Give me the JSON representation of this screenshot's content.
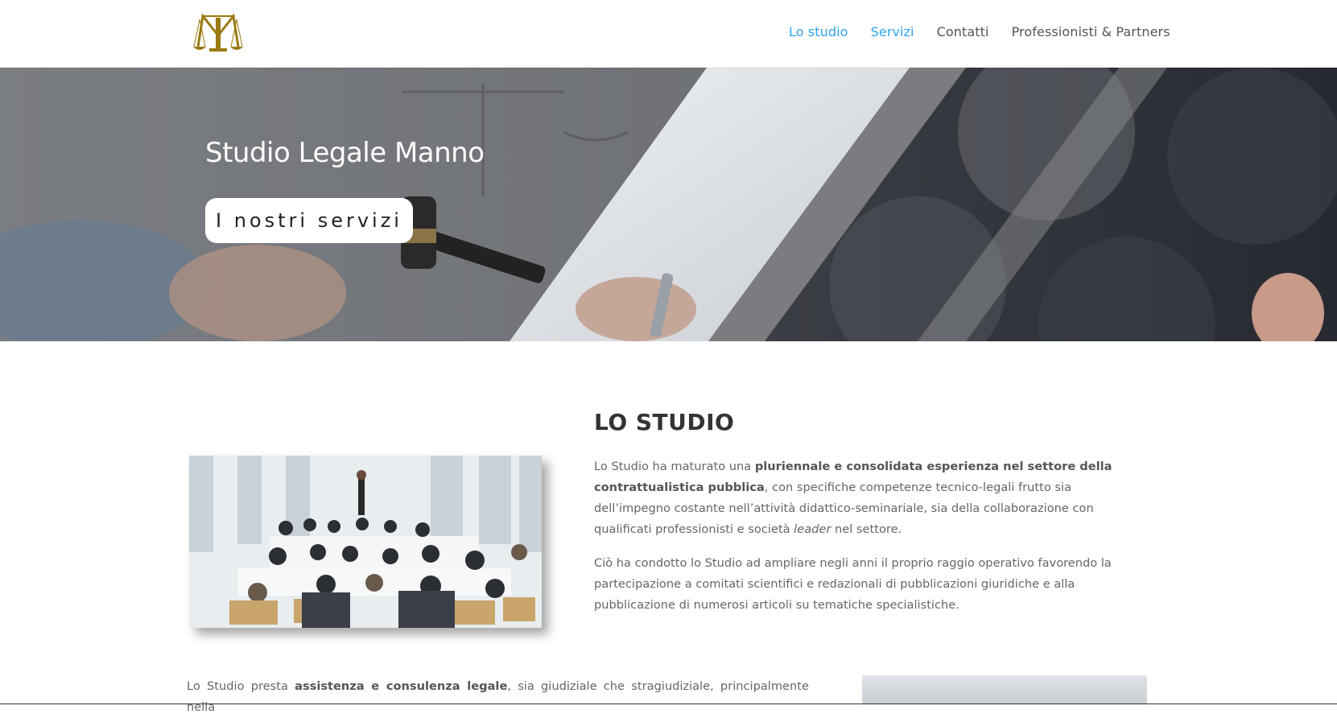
{
  "header": {
    "logo_alt": "M",
    "nav": [
      {
        "label": "Lo studio",
        "active": true
      },
      {
        "label": "Servizi",
        "active": true
      },
      {
        "label": "Contatti",
        "active": false
      },
      {
        "label": "Professionisti & Partners",
        "active": false
      }
    ]
  },
  "hero": {
    "title": "Studio Legale Manno",
    "button_label": "I nostri servizi"
  },
  "studio": {
    "title": "LO STUDIO",
    "para1": {
      "t1": "Lo Studio ha maturato una ",
      "b1": "pluriennale e consolidata esperienza nel settore della contrattualistica pubblica",
      "t2": ", con specifiche competenze tecnico-legali frutto sia dell’impegno costante nell’attività didattico-seminariale, sia della collaborazione con qualificati professionisti e società ",
      "i1": "leader",
      "t3": " nel settore."
    },
    "para2": "Ciò ha condotto lo Studio ad ampliare negli anni il proprio raggio operativo favorendo la partecipazione a comitati scientifici e redazionali di pubblicazioni giuridiche e alla pubblicazione di numerosi articoli su tematiche specialistiche.",
    "para3": {
      "t1": "Lo Studio presta ",
      "b1": "assistenza e consulenza legale",
      "t2": ", sia giudiziale che stragiudiziale, principalmente nella"
    }
  },
  "colors": {
    "accent": "#2ea3f2",
    "logo_gold": "#9a7a12",
    "hero_grey": "#6e6f72"
  }
}
